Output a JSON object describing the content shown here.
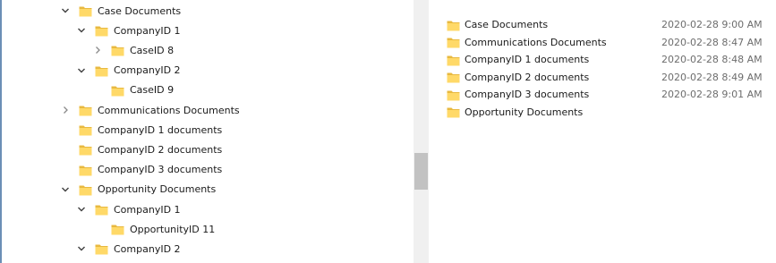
{
  "nav_tree": [
    {
      "label": "Case Documents",
      "chevron": "expanded",
      "indent": 0
    },
    {
      "label": "CompanyID 1",
      "chevron": "expanded",
      "indent": 1
    },
    {
      "label": "CaseID 8",
      "chevron": "collapsed",
      "indent": 2
    },
    {
      "label": "CompanyID 2",
      "chevron": "expanded",
      "indent": 1
    },
    {
      "label": "CaseID 9",
      "chevron": "none",
      "indent": 2
    },
    {
      "label": "Communications Documents",
      "chevron": "collapsed",
      "indent": 0
    },
    {
      "label": "CompanyID 1 documents",
      "chevron": "none",
      "indent": 0
    },
    {
      "label": "CompanyID 2 documents",
      "chevron": "none",
      "indent": 0
    },
    {
      "label": "CompanyID 3 documents",
      "chevron": "none",
      "indent": 0
    },
    {
      "label": "Opportunity Documents",
      "chevron": "expanded",
      "indent": 0
    },
    {
      "label": "CompanyID 1",
      "chevron": "expanded",
      "indent": 1
    },
    {
      "label": "OpportunityID 11",
      "chevron": "none",
      "indent": 2
    },
    {
      "label": "CompanyID 2",
      "chevron": "expanded",
      "indent": 1
    }
  ],
  "files": [
    {
      "name": "Case Documents",
      "date": "2020-02-28 9:00 AM"
    },
    {
      "name": "Communications Documents",
      "date": "2020-02-28 8:47 AM"
    },
    {
      "name": "CompanyID 1 documents",
      "date": "2020-02-28 8:48 AM"
    },
    {
      "name": "CompanyID 2 documents",
      "date": "2020-02-28 8:49 AM"
    },
    {
      "name": "CompanyID 3 documents",
      "date": "2020-02-28 9:01 AM"
    },
    {
      "name": "Opportunity Documents",
      "date": ""
    }
  ],
  "colors": {
    "folder_fill": "#ffd968",
    "folder_tab": "#e8b940",
    "chevron": "#404040",
    "date_text": "#6d6d6d",
    "window_border": "#6b8fb6"
  },
  "icons": {
    "folder": "folder-icon",
    "expanded": "chevron-down-icon",
    "collapsed": "chevron-right-icon"
  }
}
